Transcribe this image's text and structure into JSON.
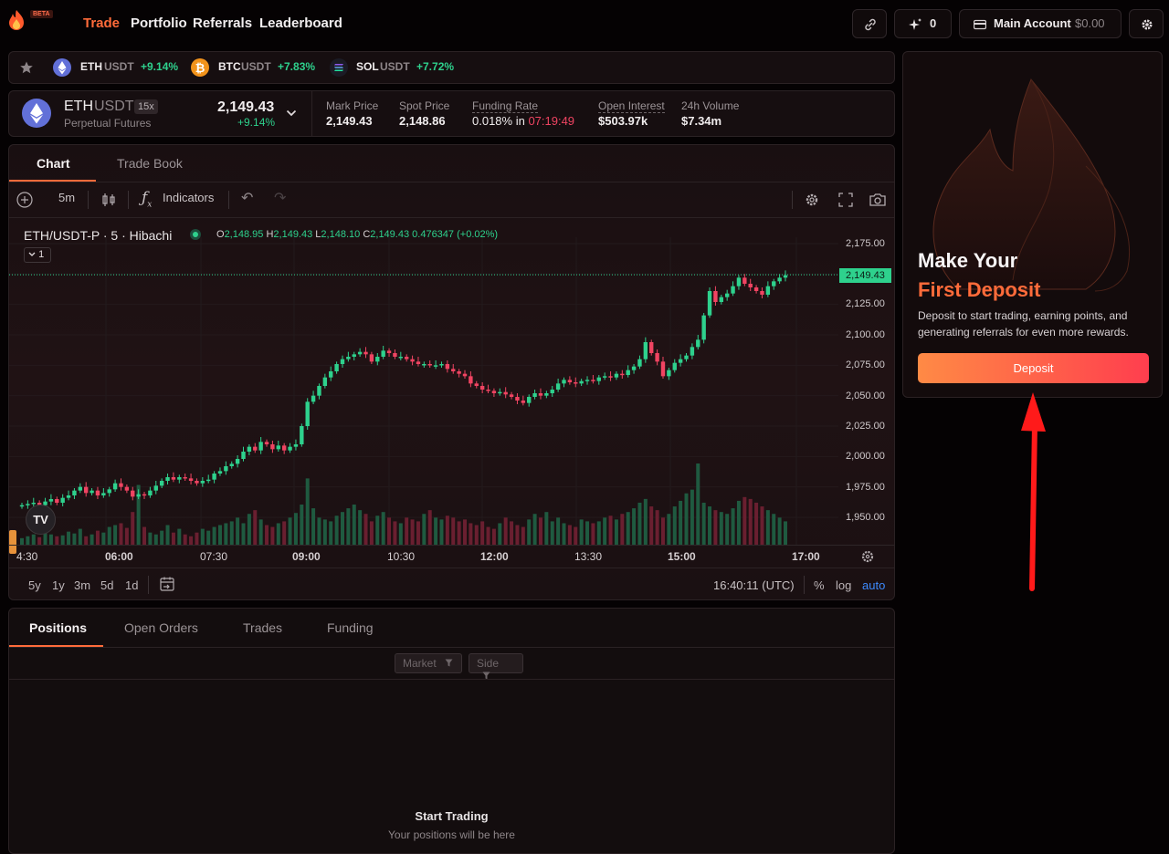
{
  "header": {
    "beta": "BETA",
    "nav": [
      "Trade",
      "Portfolio",
      "Referrals",
      "Leaderboard"
    ],
    "points": "0",
    "account_label": "Main Account",
    "account_balance": "$0.00"
  },
  "ticker": [
    {
      "base": "ETH",
      "quote": "USDT",
      "change": "+9.14%",
      "color": "#6270d8"
    },
    {
      "base": "BTC",
      "quote": "USDT",
      "change": "+7.83%",
      "color": "#f2931b"
    },
    {
      "base": "SOL",
      "quote": "USDT",
      "change": "+7.72%",
      "color": "#1b1b25"
    }
  ],
  "market": {
    "base": "ETH",
    "quote": "USDT",
    "leverage": "15x",
    "subtitle": "Perpetual Futures",
    "price": "2,149.43",
    "change": "+9.14%",
    "stats": [
      {
        "label": "Mark Price",
        "value": "2,149.43"
      },
      {
        "label": "Spot Price",
        "value": "2,148.86"
      },
      {
        "label": "Funding Rate",
        "value": "0.018%",
        "mid": " in ",
        "timer": "07:19:49"
      },
      {
        "label": "Open Interest",
        "value": "$503.97k"
      },
      {
        "label": "24h Volume",
        "value": "$7.34m"
      }
    ]
  },
  "chart_tabs": [
    "Chart",
    "Trade Book"
  ],
  "toolbar": {
    "interval": "5m",
    "indicators": "Indicators"
  },
  "legend": {
    "symbol": "ETH/USDT-P · 5 · Hibachi",
    "o": "2,148.95",
    "h": "2,149.43",
    "l": "2,148.10",
    "c": "2,149.43",
    "vol": "0.476347",
    "chg": "(+0.02%)",
    "collapse": "1"
  },
  "chart_data": {
    "type": "candlestick",
    "y_ticks": [
      "2,175.00",
      "2,150.00",
      "2,125.00",
      "2,100.00",
      "2,075.00",
      "2,050.00",
      "2,025.00",
      "2,000.00",
      "1,975.00",
      "1,950.00"
    ],
    "x_ticks": [
      "4:30",
      "06:00",
      "07:30",
      "09:00",
      "10:30",
      "12:00",
      "13:30",
      "15:00",
      "17:00"
    ],
    "last_price": "2,149.43",
    "close": [
      1960,
      1961,
      1962,
      1960,
      1963,
      1965,
      1962,
      1966,
      1968,
      1972,
      1975,
      1970,
      1972,
      1968,
      1970,
      1973,
      1978,
      1975,
      1972,
      1967,
      1969,
      1968,
      1972,
      1976,
      1980,
      1983,
      1981,
      1983,
      1982,
      1980,
      1978,
      1980,
      1981,
      1986,
      1988,
      1992,
      1994,
      1998,
      2004,
      2008,
      2005,
      2012,
      2010,
      2006,
      2009,
      2005,
      2008,
      2010,
      2025,
      2045,
      2050,
      2058,
      2065,
      2070,
      2076,
      2080,
      2082,
      2084,
      2086,
      2084,
      2078,
      2082,
      2087,
      2085,
      2082,
      2082,
      2080,
      2078,
      2076,
      2076,
      2075,
      2075,
      2076,
      2072,
      2070,
      2068,
      2066,
      2060,
      2058,
      2055,
      2054,
      2052,
      2053,
      2051,
      2049,
      2046,
      2044,
      2049,
      2052,
      2050,
      2052,
      2055,
      2060,
      2063,
      2061,
      2060,
      2062,
      2063,
      2062,
      2065,
      2066,
      2065,
      2068,
      2067,
      2071,
      2074,
      2080,
      2094,
      2085,
      2078,
      2066,
      2071,
      2077,
      2080,
      2083,
      2090,
      2096,
      2116,
      2136,
      2127,
      2131,
      2134,
      2140,
      2147,
      2142,
      2139,
      2136,
      2133,
      2140,
      2144,
      2147,
      2149
    ],
    "volume": [
      8,
      10,
      12,
      9,
      14,
      12,
      10,
      11,
      15,
      13,
      18,
      10,
      12,
      16,
      14,
      20,
      22,
      24,
      19,
      36,
      65,
      20,
      14,
      12,
      16,
      22,
      14,
      18,
      12,
      10,
      14,
      18,
      16,
      20,
      22,
      24,
      26,
      30,
      24,
      34,
      38,
      28,
      22,
      20,
      24,
      26,
      30,
      35,
      44,
      72,
      40,
      30,
      28,
      26,
      32,
      36,
      40,
      44,
      38,
      34,
      26,
      32,
      36,
      30,
      26,
      24,
      30,
      28,
      26,
      34,
      38,
      30,
      28,
      32,
      30,
      26,
      28,
      24,
      22,
      26,
      20,
      18,
      24,
      30,
      26,
      22,
      20,
      28,
      34,
      30,
      36,
      26,
      30,
      24,
      22,
      20,
      28,
      26,
      24,
      26,
      30,
      32,
      28,
      34,
      36,
      40,
      46,
      50,
      42,
      38,
      30,
      34,
      42,
      48,
      56,
      60,
      88,
      46,
      42,
      38,
      36,
      34,
      40,
      48,
      52,
      50,
      46,
      42,
      38,
      34,
      30,
      26
    ],
    "time_readout": "16:40:11 (UTC)",
    "ranges": [
      "5y",
      "1y",
      "3m",
      "5d",
      "1d"
    ],
    "scale_opts": [
      "%",
      "log",
      "auto"
    ]
  },
  "positions": {
    "tabs": [
      "Positions",
      "Open Orders",
      "Trades",
      "Funding"
    ],
    "filters": [
      "Market",
      "Side"
    ],
    "empty_title": "Start Trading",
    "empty_sub": "Your positions will be here"
  },
  "promo": {
    "title1": "Make Your",
    "title2": "First Deposit",
    "body": "Deposit to start trading, earning points, and generating referrals for even more rewards.",
    "button": "Deposit"
  },
  "colors": {
    "accent": "#ff6b3a",
    "up": "#2ed18d",
    "down": "#f04462"
  }
}
